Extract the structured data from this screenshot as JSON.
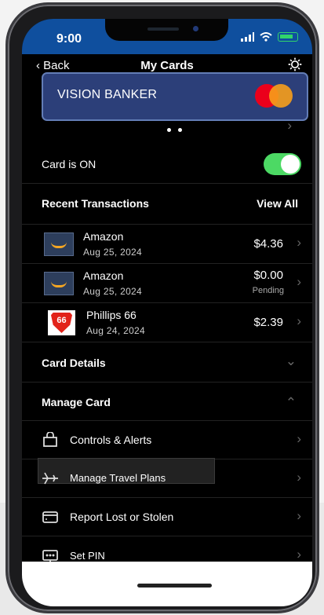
{
  "status": {
    "time": "9:00"
  },
  "nav": {
    "back": "Back",
    "title": "My Cards"
  },
  "card": {
    "name": "VISION BANKER"
  },
  "card_status": {
    "label": "Card is ON"
  },
  "recent": {
    "title": "Recent Transactions",
    "view_all": "View All"
  },
  "transactions": [
    {
      "merchant": "Amazon",
      "date": "Aug 25, 2024",
      "amount": "$4.36",
      "status": ""
    },
    {
      "merchant": "Amazon",
      "date": "Aug 25, 2024",
      "amount": "$0.00",
      "status": "Pending"
    },
    {
      "merchant": "Phillips 66",
      "date": "Aug 24, 2024",
      "amount": "$2.39",
      "status": ""
    }
  ],
  "logo": {
    "phillips": "66"
  },
  "sections": {
    "card_details": "Card Details",
    "manage_card": "Manage Card"
  },
  "menu": [
    {
      "label": "Controls & Alerts"
    },
    {
      "label": "Manage Travel Plans"
    },
    {
      "label": "Report Lost or Stolen"
    },
    {
      "label": "Set PIN"
    }
  ],
  "icons": {
    "back": "chevron-left-icon",
    "settings": "gear-icon",
    "dropdown": "chevron-down-icon",
    "collapse": "chevron-up-icon"
  },
  "colors": {
    "status_bar": "#0f4f9e",
    "toggle": "#4cd964",
    "card": "#2c3f79"
  }
}
